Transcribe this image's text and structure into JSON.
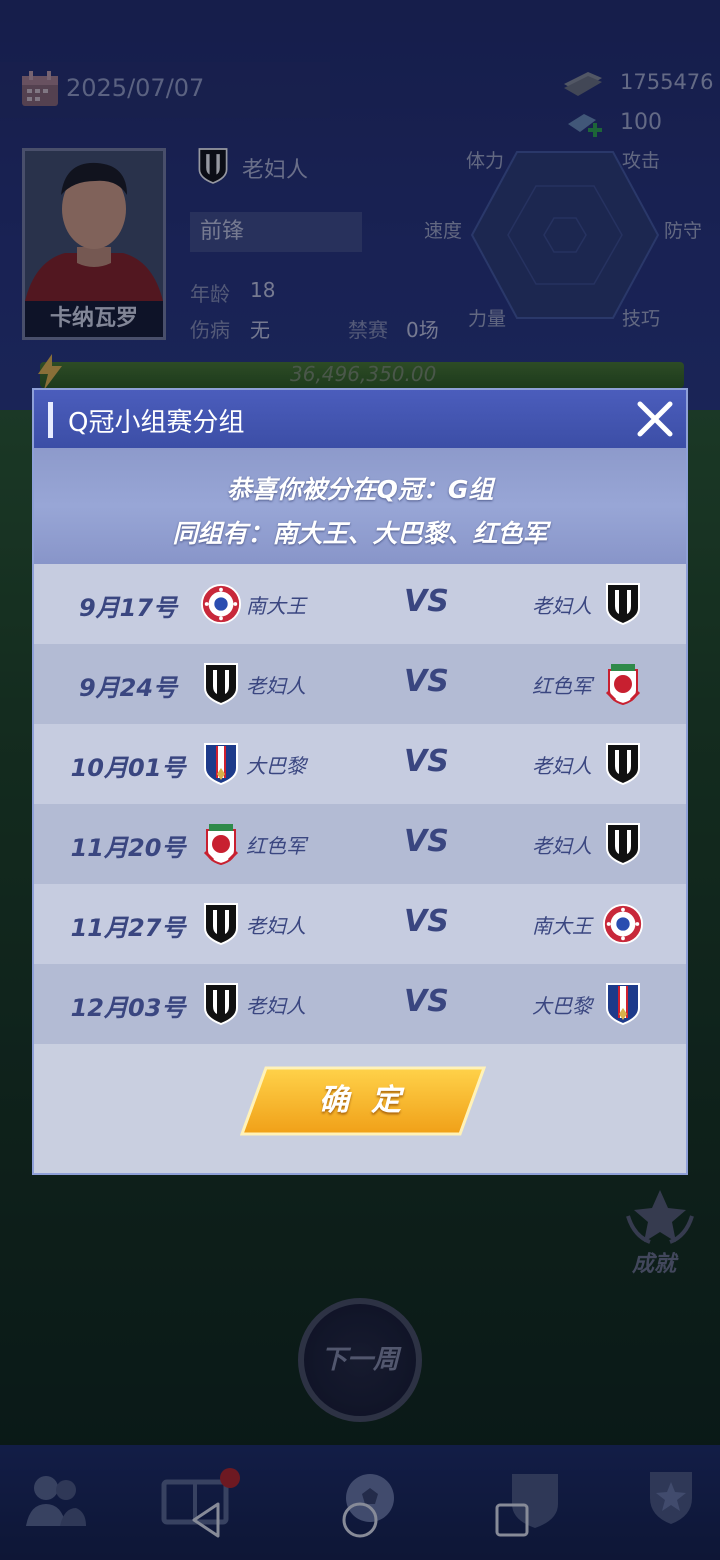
{
  "colors": {
    "dialog_header": "#4b5dbc",
    "dialog_body": "#c9cfe0",
    "row_text": "#3a4680",
    "confirm_button": "#f5b22a",
    "nav_badge": "#b82525"
  },
  "header": {
    "date": "2025/07/07",
    "money": "1755476",
    "gems": "100"
  },
  "player": {
    "name": "卡纳瓦罗",
    "club": "老妇人",
    "position": "前锋",
    "age_label": "年龄",
    "age": "18",
    "injury_label": "伤病",
    "injury": "无",
    "ban_label": "禁赛",
    "ban": "0场",
    "value": "36,496,350.00",
    "attributes": [
      "体力",
      "攻击",
      "防守",
      "技巧",
      "力量",
      "速度"
    ]
  },
  "dialog": {
    "title": "Q冠小组赛分组",
    "line1": "恭喜你被分在Q冠：G组",
    "line2": "同组有：南大王、大巴黎、红色军",
    "vs": "VS",
    "confirm": "确定",
    "matches": [
      {
        "date": "9月17号",
        "home": "南大王",
        "home_icon": "nandawang-badge-icon",
        "away": "老妇人",
        "away_icon": "laofuren-badge-icon"
      },
      {
        "date": "9月24号",
        "home": "老妇人",
        "home_icon": "laofuren-badge-icon",
        "away": "红色军",
        "away_icon": "hongsejun-badge-icon"
      },
      {
        "date": "10月01号",
        "home": "大巴黎",
        "home_icon": "dabali-badge-icon",
        "away": "老妇人",
        "away_icon": "laofuren-badge-icon"
      },
      {
        "date": "11月20号",
        "home": "红色军",
        "home_icon": "hongsejun-badge-icon",
        "away": "老妇人",
        "away_icon": "laofuren-badge-icon"
      },
      {
        "date": "11月27号",
        "home": "老妇人",
        "home_icon": "laofuren-badge-icon",
        "away": "南大王",
        "away_icon": "nandawang-badge-icon"
      },
      {
        "date": "12月03号",
        "home": "老妇人",
        "home_icon": "laofuren-badge-icon",
        "away": "大巴黎",
        "away_icon": "dabali-badge-icon"
      }
    ]
  },
  "main": {
    "achievements": "成就",
    "next_week": "下一周"
  },
  "nav": {
    "icons": [
      "players-icon",
      "tactics-board-icon",
      "match-ball-icon",
      "club-crest-icon",
      "trophy-icon"
    ]
  }
}
